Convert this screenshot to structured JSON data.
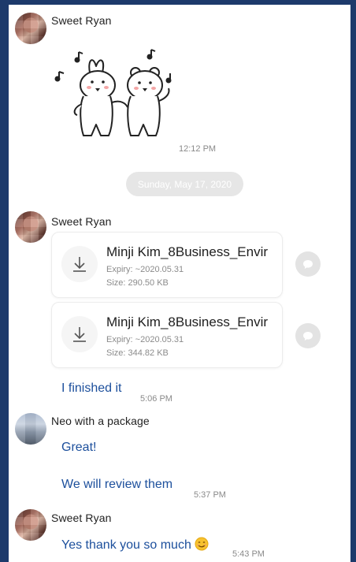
{
  "senders": {
    "ryan": "Sweet Ryan",
    "neo": "Neo with a package"
  },
  "sticker": {
    "icon": "bear-bunny-dancing-sticker",
    "time": "12:12 PM"
  },
  "date_separator": "Sunday, May 17, 2020",
  "files": [
    {
      "name": "Minji Kim_8Business_Envir",
      "expiry": "Expiry: ~2020.05.31",
      "size": "Size: 290.50 KB"
    },
    {
      "name": "Minji Kim_8Business_Envir",
      "expiry": "Expiry: ~2020.05.31",
      "size": "Size: 344.82 KB"
    }
  ],
  "messages": {
    "finished": {
      "text": "I finished it",
      "time": "5:06 PM"
    },
    "great": {
      "text": "Great!"
    },
    "review": {
      "text": "We will review them",
      "time": "5:37 PM"
    },
    "thanks": {
      "text": "Yes thank you so much",
      "time": "5:43 PM"
    }
  },
  "colors": {
    "background_frame": "#1d3a6b",
    "message_text": "#1c4f9c",
    "date_pill": "#e6e6e6"
  }
}
